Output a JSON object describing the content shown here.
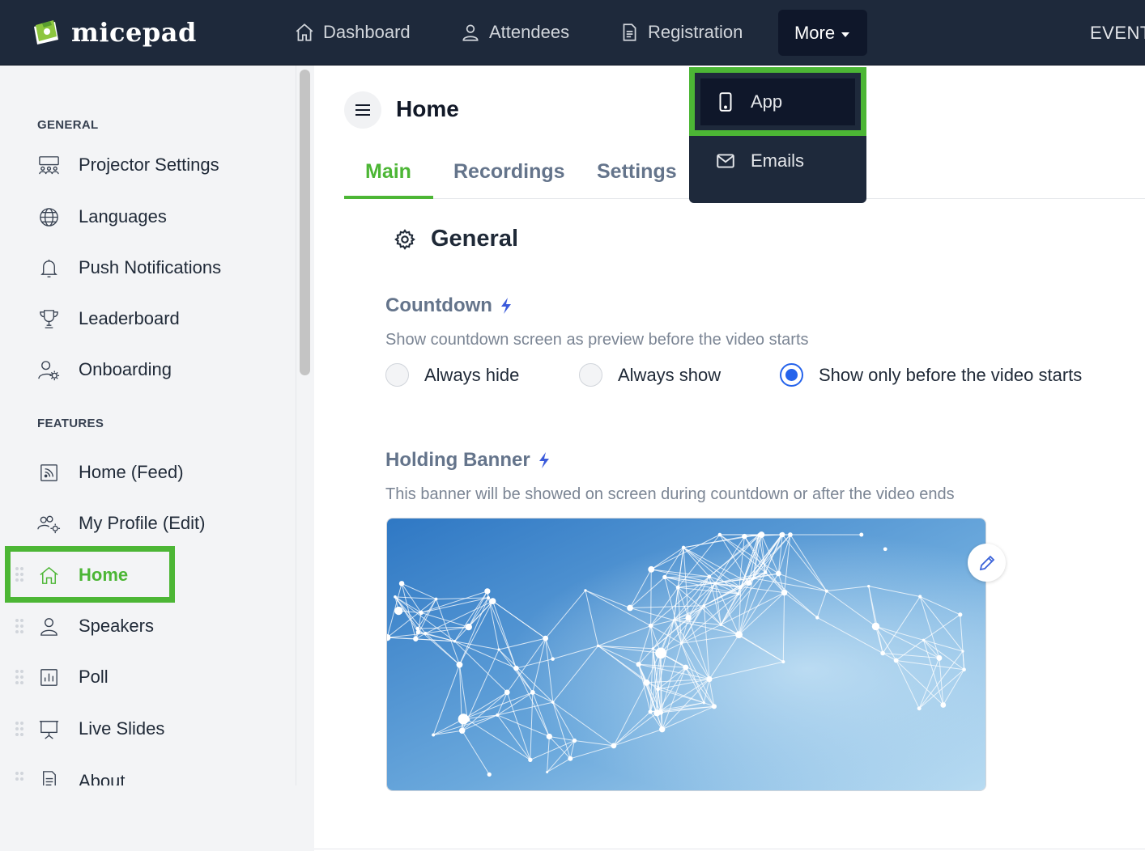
{
  "brand": {
    "name": "micepad"
  },
  "nav": {
    "items": [
      {
        "label": "Dashboard",
        "icon": "home-icon"
      },
      {
        "label": "Attendees",
        "icon": "user-icon"
      },
      {
        "label": "Registration",
        "icon": "document-icon"
      }
    ],
    "more_label": "More",
    "event_label": "EVENT"
  },
  "dropdown": {
    "items": [
      {
        "label": "App",
        "icon": "phone-icon"
      },
      {
        "label": "Emails",
        "icon": "mail-icon"
      }
    ]
  },
  "sidebar": {
    "general_title": "GENERAL",
    "general_items": [
      {
        "label": "Projector Settings",
        "icon": "projector-audience-icon"
      },
      {
        "label": "Languages",
        "icon": "globe-icon"
      },
      {
        "label": "Push Notifications",
        "icon": "bell-icon"
      },
      {
        "label": "Leaderboard",
        "icon": "trophy-icon"
      },
      {
        "label": "Onboarding",
        "icon": "user-gear-icon"
      }
    ],
    "features_title": "FEATURES",
    "feature_items": [
      {
        "label": "Home (Feed)",
        "icon": "feed-icon"
      },
      {
        "label": "My Profile (Edit)",
        "icon": "users-gear-icon"
      },
      {
        "label": "Home",
        "icon": "home-icon",
        "active": true
      },
      {
        "label": "Speakers",
        "icon": "user-icon"
      },
      {
        "label": "Poll",
        "icon": "bar-chart-icon"
      },
      {
        "label": "Live Slides",
        "icon": "presentation-icon"
      },
      {
        "label": "About",
        "icon": "document-icon"
      }
    ]
  },
  "page": {
    "title": "Home",
    "tabs": [
      {
        "label": "Main",
        "active": true
      },
      {
        "label": "Recordings",
        "active": false
      },
      {
        "label": "Settings",
        "active": false
      }
    ],
    "section_title": "General",
    "countdown": {
      "title": "Countdown",
      "description": "Show countdown screen as preview before the video starts",
      "options": [
        {
          "label": "Always hide",
          "selected": false
        },
        {
          "label": "Always show",
          "selected": false
        },
        {
          "label": "Show only before the video starts",
          "selected": true
        }
      ]
    },
    "holding_banner": {
      "title": "Holding Banner",
      "description": "This banner will be showed on screen during countdown or after the video ends"
    }
  },
  "colors": {
    "topbar": "#1e293b",
    "accent_green": "#4cb635",
    "radio_blue": "#2563eb",
    "bolt_blue": "#3b5bdb"
  }
}
